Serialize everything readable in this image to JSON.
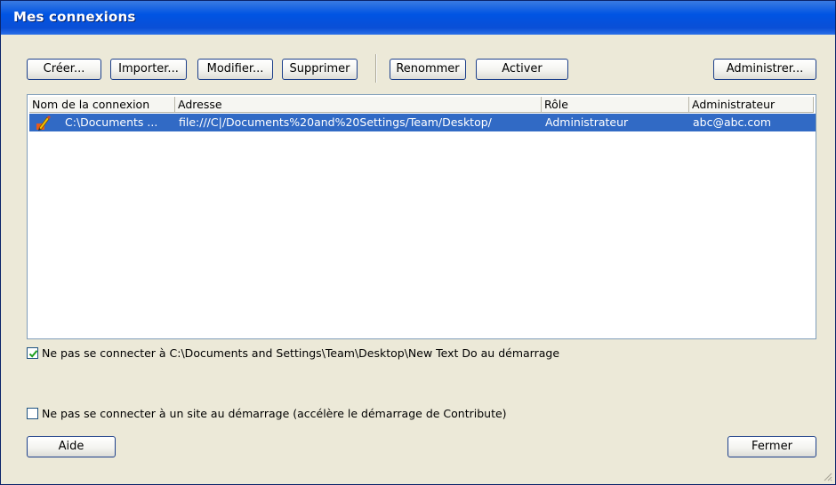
{
  "window": {
    "title": "Mes connexions"
  },
  "toolbar": {
    "create": "Créer...",
    "import": "Importer...",
    "modify": "Modifier...",
    "delete": "Supprimer",
    "rename": "Renommer",
    "activate": "Activer",
    "administer": "Administrer..."
  },
  "table": {
    "columns": [
      "Nom de la connexion",
      "Adresse",
      "Rôle",
      "Administrateur"
    ],
    "rows": [
      {
        "name": "C:\\Documents ...",
        "address": "file:///C|/Documents%20and%20Settings/Team/Desktop/",
        "role": "Administrateur",
        "admin": "abc@abc.com",
        "icon": "pencil-connection-icon",
        "selected": true
      }
    ]
  },
  "options": {
    "no_connect_file": {
      "label": "Ne pas se connecter à C:\\Documents and Settings\\Team\\Desktop\\New Text Do au démarrage",
      "checked": true
    },
    "no_connect_site": {
      "label": "Ne pas se connecter à un site au démarrage (accélère le démarrage de Contribute)",
      "checked": false
    }
  },
  "footer": {
    "help": "Aide",
    "close": "Fermer"
  },
  "colors": {
    "titlebar": "#0054e3",
    "selection": "#316ac5",
    "dialog_bg": "#ece9d8",
    "checkmark": "#21a121"
  }
}
